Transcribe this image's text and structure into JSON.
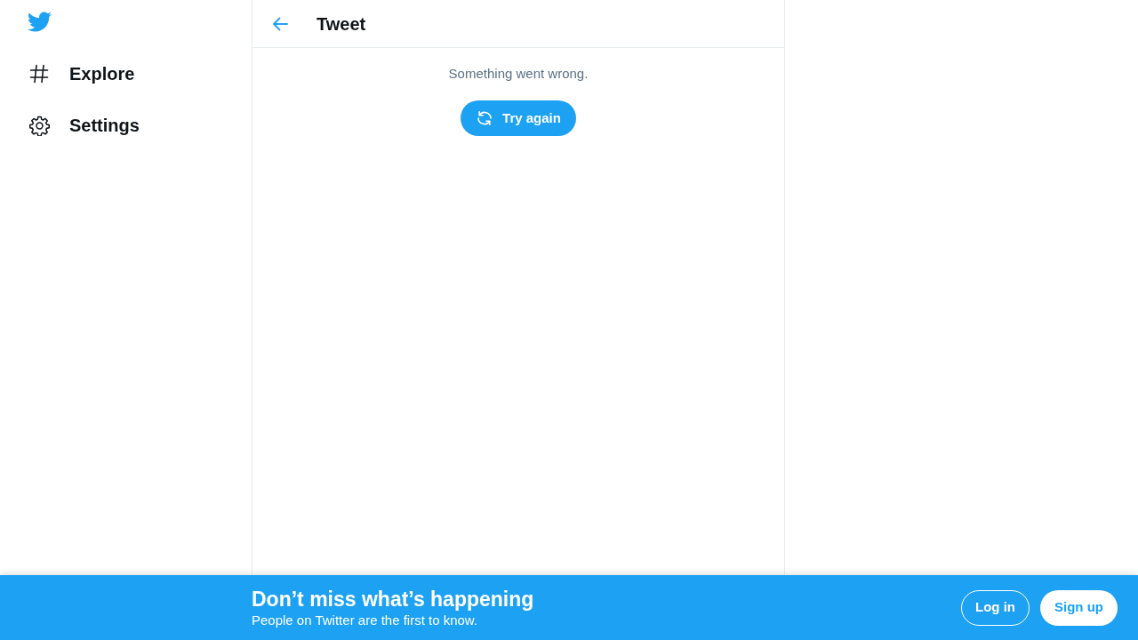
{
  "sidebar": {
    "items": [
      {
        "label": "Explore",
        "kind": "hashtag"
      },
      {
        "label": "Settings",
        "kind": "gear"
      }
    ]
  },
  "header": {
    "title": "Tweet"
  },
  "error": {
    "message": "Something went wrong.",
    "button": "Try again"
  },
  "banner": {
    "title": "Don’t miss what’s happening",
    "subtitle": "People on Twitter are the first to know.",
    "buttons": [
      {
        "label": "Log in",
        "kind": "outline"
      },
      {
        "label": "Sign up",
        "kind": "filled"
      }
    ]
  }
}
